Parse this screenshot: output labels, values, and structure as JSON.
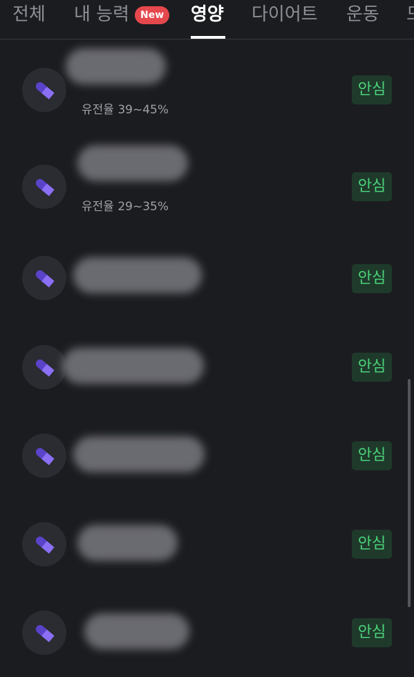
{
  "tabs": [
    {
      "label": "전체"
    },
    {
      "label": "내 능력",
      "badge": "New"
    },
    {
      "label": "영양",
      "active": true
    },
    {
      "label": "다이어트"
    },
    {
      "label": "운동"
    },
    {
      "label": "므"
    }
  ],
  "items": [
    {
      "subtitle": "유전율 39~45%",
      "status": "안심",
      "icon": "pill-icon"
    },
    {
      "subtitle": "유전율 29~35%",
      "status": "안심",
      "icon": "pill-icon"
    },
    {
      "subtitle": "",
      "status": "안심",
      "icon": "pill-icon"
    },
    {
      "subtitle": "",
      "status": "안심",
      "icon": "pill-icon"
    },
    {
      "subtitle": "",
      "status": "안심",
      "icon": "pill-icon"
    },
    {
      "subtitle": "",
      "status": "안심",
      "icon": "pill-icon"
    },
    {
      "subtitle": "",
      "status": "안심",
      "icon": "pill-icon"
    }
  ],
  "colors": {
    "background": "#1b1c20",
    "status_text": "#4bd37b",
    "status_bg": "#1f3a2b",
    "badge_new": "#e5484d",
    "pill_icon": "#7b5cf0"
  }
}
